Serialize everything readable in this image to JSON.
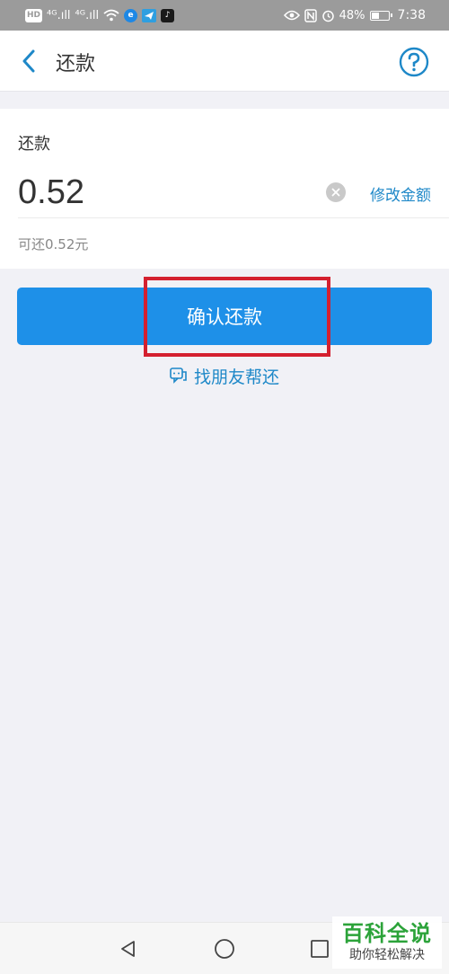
{
  "statusbar": {
    "hd": "HD",
    "signal1": "⁴ᴳ.ıll",
    "signal2": "⁴ᴳ.ıll",
    "battery_text": "48%",
    "battery_level": 0.48,
    "time": "7:38"
  },
  "header": {
    "title": "还款"
  },
  "repay": {
    "label": "还款",
    "amount": "0.52",
    "modify_label": "修改金额",
    "available": "可还0.52元"
  },
  "actions": {
    "confirm_label": "确认还款",
    "friend_label": "找朋友帮还"
  },
  "watermark": {
    "title": "百科全说",
    "subtitle": "助你轻松解决"
  },
  "colors": {
    "accent": "#1e90e8",
    "link": "#1e88c8",
    "highlight": "#d4202f",
    "watermark": "#2ca33a"
  }
}
